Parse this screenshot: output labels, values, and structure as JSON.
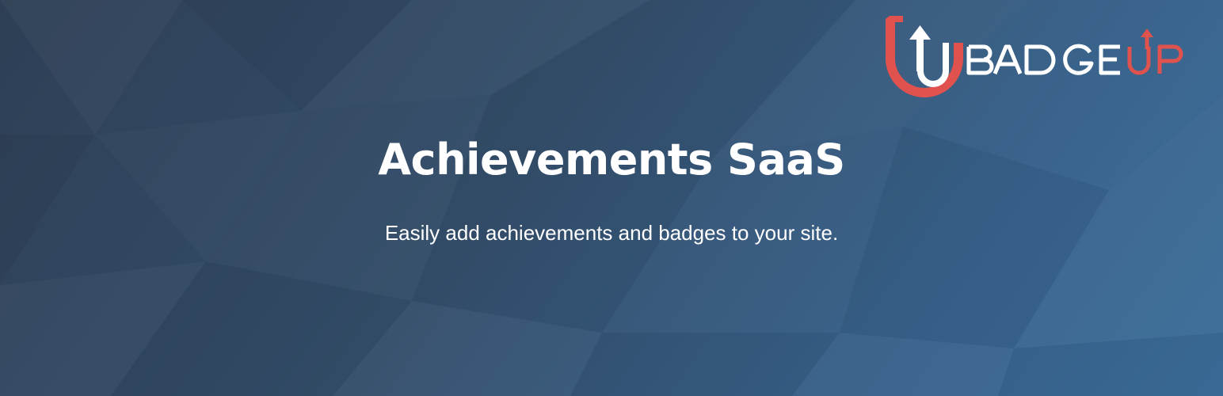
{
  "banner": {
    "logo": {
      "wordmark": "BADGEUP",
      "accent_color": "#e0524d",
      "text_color": "#ffffff"
    },
    "headline": "Achievements SaaS",
    "tagline": "Easily add achievements and badges to your site."
  }
}
